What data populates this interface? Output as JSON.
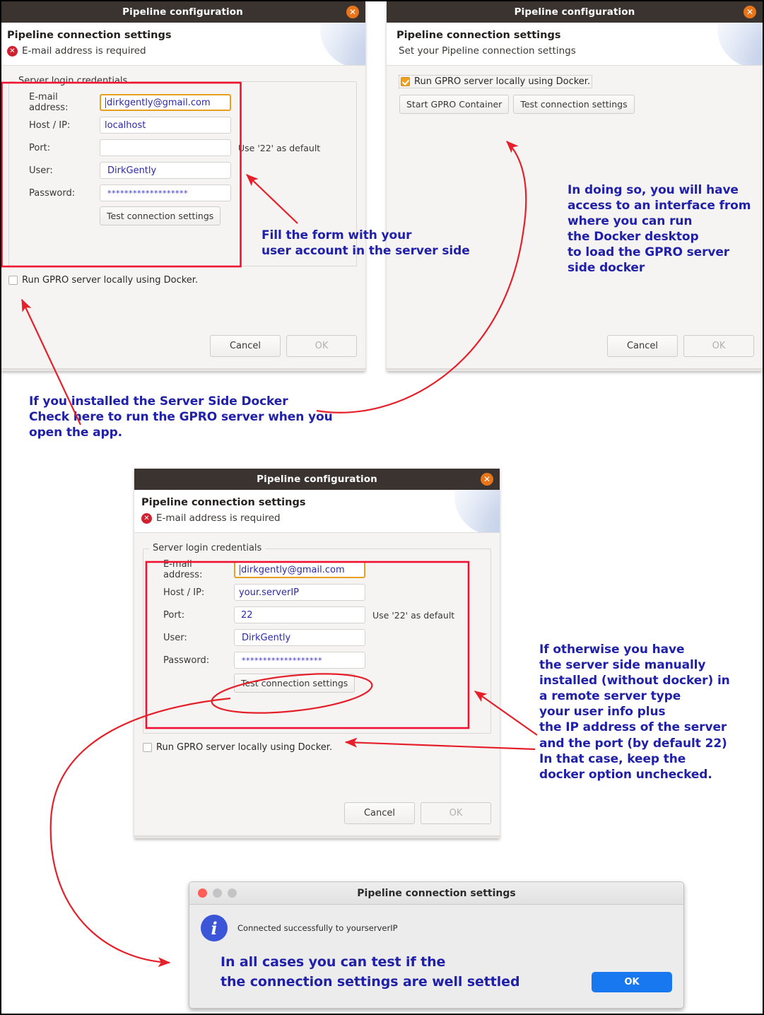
{
  "dialog1": {
    "title": "Pipeline configuration",
    "close_icon": "close-icon",
    "header_title": "Pipeline connection settings",
    "error_text": "E-mail address is required",
    "group_legend": "Server login credentials",
    "fields": [
      {
        "label": "E-mail address:",
        "value": "dirkgently@gmail.com",
        "hint": ""
      },
      {
        "label": "Host / IP:",
        "value": "localhost",
        "hint": ""
      },
      {
        "label": "Port:",
        "value": "",
        "hint": "Use '22' as default"
      },
      {
        "label": "User:",
        "value": "DirkGently",
        "hint": ""
      },
      {
        "label": "Password:",
        "value": "*******************",
        "hint": ""
      }
    ],
    "test_button": "Test connection settings",
    "docker_checkbox": "Run GPRO server locally using Docker.",
    "docker_checked": false,
    "cancel": "Cancel",
    "ok": "OK"
  },
  "dialog2": {
    "title": "Pipeline configuration",
    "header_title": "Pipeline connection settings",
    "subtitle": "Set your Pipeline connection settings",
    "docker_checkbox": "Run GPRO server locally using Docker.",
    "docker_checked": true,
    "start_container_button": "Start GPRO Container",
    "test_button": "Test connection settings",
    "cancel": "Cancel",
    "ok": "OK"
  },
  "dialog3": {
    "title": "Pipeline configuration",
    "header_title": "Pipeline connection settings",
    "error_text": "E-mail address is required",
    "group_legend": "Server login credentials",
    "fields": [
      {
        "label": "E-mail address:",
        "value": "dirkgently@gmail.com",
        "hint": ""
      },
      {
        "label": "Host / IP:",
        "value": "your.serverIP",
        "hint": ""
      },
      {
        "label": "Port:",
        "value": "22",
        "hint": "Use '22' as default"
      },
      {
        "label": "User:",
        "value": "DirkGently",
        "hint": ""
      },
      {
        "label": "Password:",
        "value": "*******************",
        "hint": ""
      }
    ],
    "test_button": "Test connection settings",
    "docker_checkbox": "Run GPRO server locally using Docker.",
    "docker_checked": false,
    "cancel": "Cancel",
    "ok": "OK"
  },
  "mac_dialog": {
    "title": "Pipeline connection settings",
    "message": "Connected successfully to yourserverIP",
    "ok": "OK",
    "lights": [
      "#ff5f57",
      "#c4c4c4",
      "#c4c4c4"
    ]
  },
  "annotations": {
    "fill_form": "Fill the form with your\nuser account in the server side",
    "docker_info": "In doing so, you will have\naccess to an interface from\nwhere you can run\nthe Docker desktop\nto load the GPRO server\nside docker",
    "server_side_docker": "If you installed the Server Side Docker\nCheck here to run the GPRO server when you\nopen the app.",
    "manual_install": "If otherwise you have\nthe server side manually\ninstalled (without docker) in\na remote server type\nyour user info plus\nthe IP address of the server\nand the port (by default 22)\nIn that case, keep the\ndocker option unchecked.",
    "test_connection": "In all cases you can test if the\nthe connection settings are well settled"
  },
  "colors": {
    "annotation_text": "#2020a8",
    "arrow_red": "#e5202a",
    "highlight_box": "#f01030",
    "titlebar": "#3b3330",
    "close_orange": "#e8751a",
    "checkbox_on": "#f0a11e",
    "focus_orange": "#e8a020",
    "field_text": "#2c2aa8",
    "mac_ok_blue": "#1878f0"
  }
}
